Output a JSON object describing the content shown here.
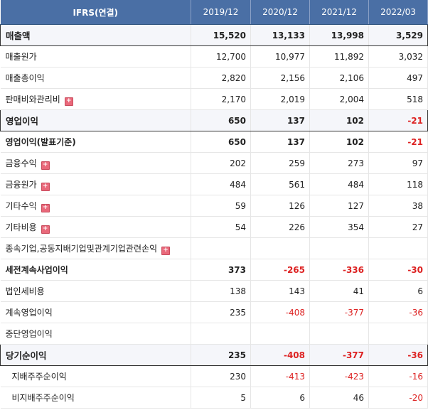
{
  "header": {
    "label": "IFRS(연결)",
    "periods": [
      "2019/12",
      "2020/12",
      "2021/12",
      "2022/03"
    ]
  },
  "rows": [
    {
      "label": "매출액",
      "values": [
        "15,520",
        "13,133",
        "13,998",
        "3,529"
      ],
      "neg": [
        false,
        false,
        false,
        false
      ]
    },
    {
      "label": "매출원가",
      "values": [
        "12,700",
        "10,977",
        "11,892",
        "3,032"
      ],
      "neg": [
        false,
        false,
        false,
        false
      ]
    },
    {
      "label": "매출총이익",
      "values": [
        "2,820",
        "2,156",
        "2,106",
        "497"
      ],
      "neg": [
        false,
        false,
        false,
        false
      ]
    },
    {
      "label": "판매비와관리비",
      "values": [
        "2,170",
        "2,019",
        "2,004",
        "518"
      ],
      "neg": [
        false,
        false,
        false,
        false
      ]
    },
    {
      "label": "영업이익",
      "values": [
        "650",
        "137",
        "102",
        "-21"
      ],
      "neg": [
        false,
        false,
        false,
        true
      ]
    },
    {
      "label": "영업이익(발표기준)",
      "values": [
        "650",
        "137",
        "102",
        "-21"
      ],
      "neg": [
        false,
        false,
        false,
        true
      ]
    },
    {
      "label": "금융수익",
      "values": [
        "202",
        "259",
        "273",
        "97"
      ],
      "neg": [
        false,
        false,
        false,
        false
      ]
    },
    {
      "label": "금융원가",
      "values": [
        "484",
        "561",
        "484",
        "118"
      ],
      "neg": [
        false,
        false,
        false,
        false
      ]
    },
    {
      "label": "기타수익",
      "values": [
        "59",
        "126",
        "127",
        "38"
      ],
      "neg": [
        false,
        false,
        false,
        false
      ]
    },
    {
      "label": "기타비용",
      "values": [
        "54",
        "226",
        "354",
        "27"
      ],
      "neg": [
        false,
        false,
        false,
        false
      ]
    },
    {
      "label": "종속기업,공동지배기업및관계기업관련손익",
      "values": [
        "",
        "",
        "",
        ""
      ],
      "neg": [
        false,
        false,
        false,
        false
      ]
    },
    {
      "label": "세전계속사업이익",
      "values": [
        "373",
        "-265",
        "-336",
        "-30"
      ],
      "neg": [
        false,
        true,
        true,
        true
      ]
    },
    {
      "label": "법인세비용",
      "values": [
        "138",
        "143",
        "41",
        "6"
      ],
      "neg": [
        false,
        false,
        false,
        false
      ]
    },
    {
      "label": "계속영업이익",
      "values": [
        "235",
        "-408",
        "-377",
        "-36"
      ],
      "neg": [
        false,
        true,
        true,
        true
      ]
    },
    {
      "label": "중단영업이익",
      "values": [
        "",
        "",
        "",
        ""
      ],
      "neg": [
        false,
        false,
        false,
        false
      ]
    },
    {
      "label": "당기순이익",
      "values": [
        "235",
        "-408",
        "-377",
        "-36"
      ],
      "neg": [
        false,
        true,
        true,
        true
      ]
    },
    {
      "label": "지배주주순이익",
      "values": [
        "230",
        "-413",
        "-423",
        "-16"
      ],
      "neg": [
        false,
        true,
        true,
        true
      ]
    },
    {
      "label": "비지배주주순이익",
      "values": [
        "5",
        "6",
        "46",
        "-20"
      ],
      "neg": [
        false,
        false,
        false,
        true
      ]
    }
  ],
  "expand_icon": "plus-icon",
  "expand_symbol": "+"
}
